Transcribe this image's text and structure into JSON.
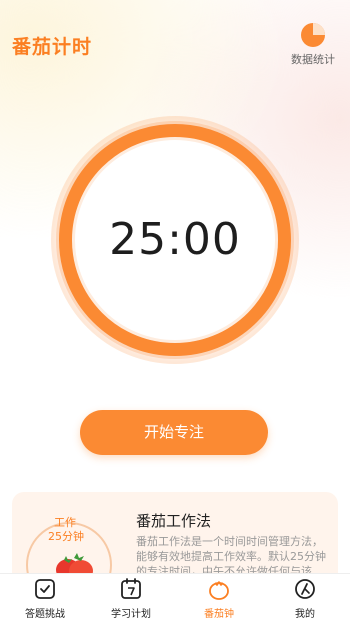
{
  "header": {
    "title": "番茄计时",
    "stats_label": "数据统计"
  },
  "timer": {
    "display": "25:00"
  },
  "start_button": {
    "label": "开始专注"
  },
  "info_card": {
    "illus_work": "工作",
    "illus_minutes": "25分钟",
    "title": "番茄工作法",
    "description": "番茄工作法是一个时间时间管理方法，能够有效地提高工作效率。默认25分钟的专注时间，中午不允许做任何与该"
  },
  "tabbar": {
    "items": [
      {
        "label": "答题挑战",
        "icon": "quiz-icon",
        "active": false
      },
      {
        "label": "学习计划",
        "icon": "calendar-icon",
        "active": false
      },
      {
        "label": "番茄钟",
        "icon": "tomato-icon",
        "active": true
      },
      {
        "label": "我的",
        "icon": "profile-icon",
        "active": false
      }
    ]
  },
  "colors": {
    "accent": "#fb8a33",
    "title": "#fb7f22"
  }
}
